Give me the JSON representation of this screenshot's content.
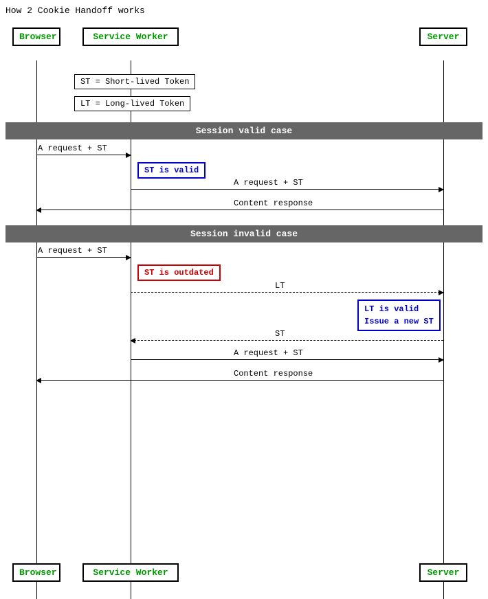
{
  "title": "How 2 Cookie Handoff works",
  "actors": {
    "browser": "Browser",
    "serviceWorker": "Service Worker",
    "server": "Server"
  },
  "sections": {
    "valid": "Session valid case",
    "invalid": "Session invalid case"
  },
  "legend": {
    "st": "ST = Short-lived Token",
    "lt": "LT = Long-lived Token"
  },
  "arrows": {
    "requestST": "A request + ST",
    "contentResponse": "Content response",
    "lt": "LT",
    "st": "ST",
    "requestST2": "A request + ST"
  },
  "annotations": {
    "stValid": "ST is valid",
    "stOutdated": "ST is outdated",
    "ltValid": "LT is valid\nIssue a new ST"
  }
}
